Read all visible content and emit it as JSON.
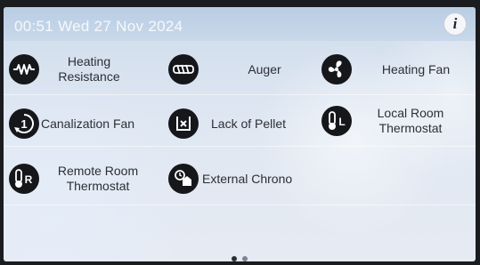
{
  "status_bar": {
    "datetime": "00:51 Wed 27 Nov 2024",
    "info_label": "i"
  },
  "items": [
    {
      "label_lines": [
        "Heating",
        "Resistance"
      ],
      "icon": "heating-resistance-icon"
    },
    {
      "label_lines": [
        "Auger"
      ],
      "icon": "auger-icon"
    },
    {
      "label_lines": [
        "Heating Fan"
      ],
      "icon": "fan-icon"
    },
    {
      "label_lines": [
        "Canalization Fan"
      ],
      "icon": "canalization-fan-icon"
    },
    {
      "label_lines": [
        "Lack of Pellet"
      ],
      "icon": "pellet-hopper-icon"
    },
    {
      "label_lines": [
        "Local Room",
        "Thermostat"
      ],
      "icon": "local-thermostat-icon"
    },
    {
      "label_lines": [
        "Remote Room",
        "Thermostat"
      ],
      "icon": "remote-thermostat-icon"
    },
    {
      "label_lines": [
        "External Chrono"
      ],
      "icon": "external-chrono-icon"
    }
  ],
  "pager": {
    "pages": 2,
    "current": 1
  },
  "colors": {
    "icon_bg": "#15171a",
    "text": "#2c2f35",
    "screen_bg": "#dfe7f2"
  }
}
